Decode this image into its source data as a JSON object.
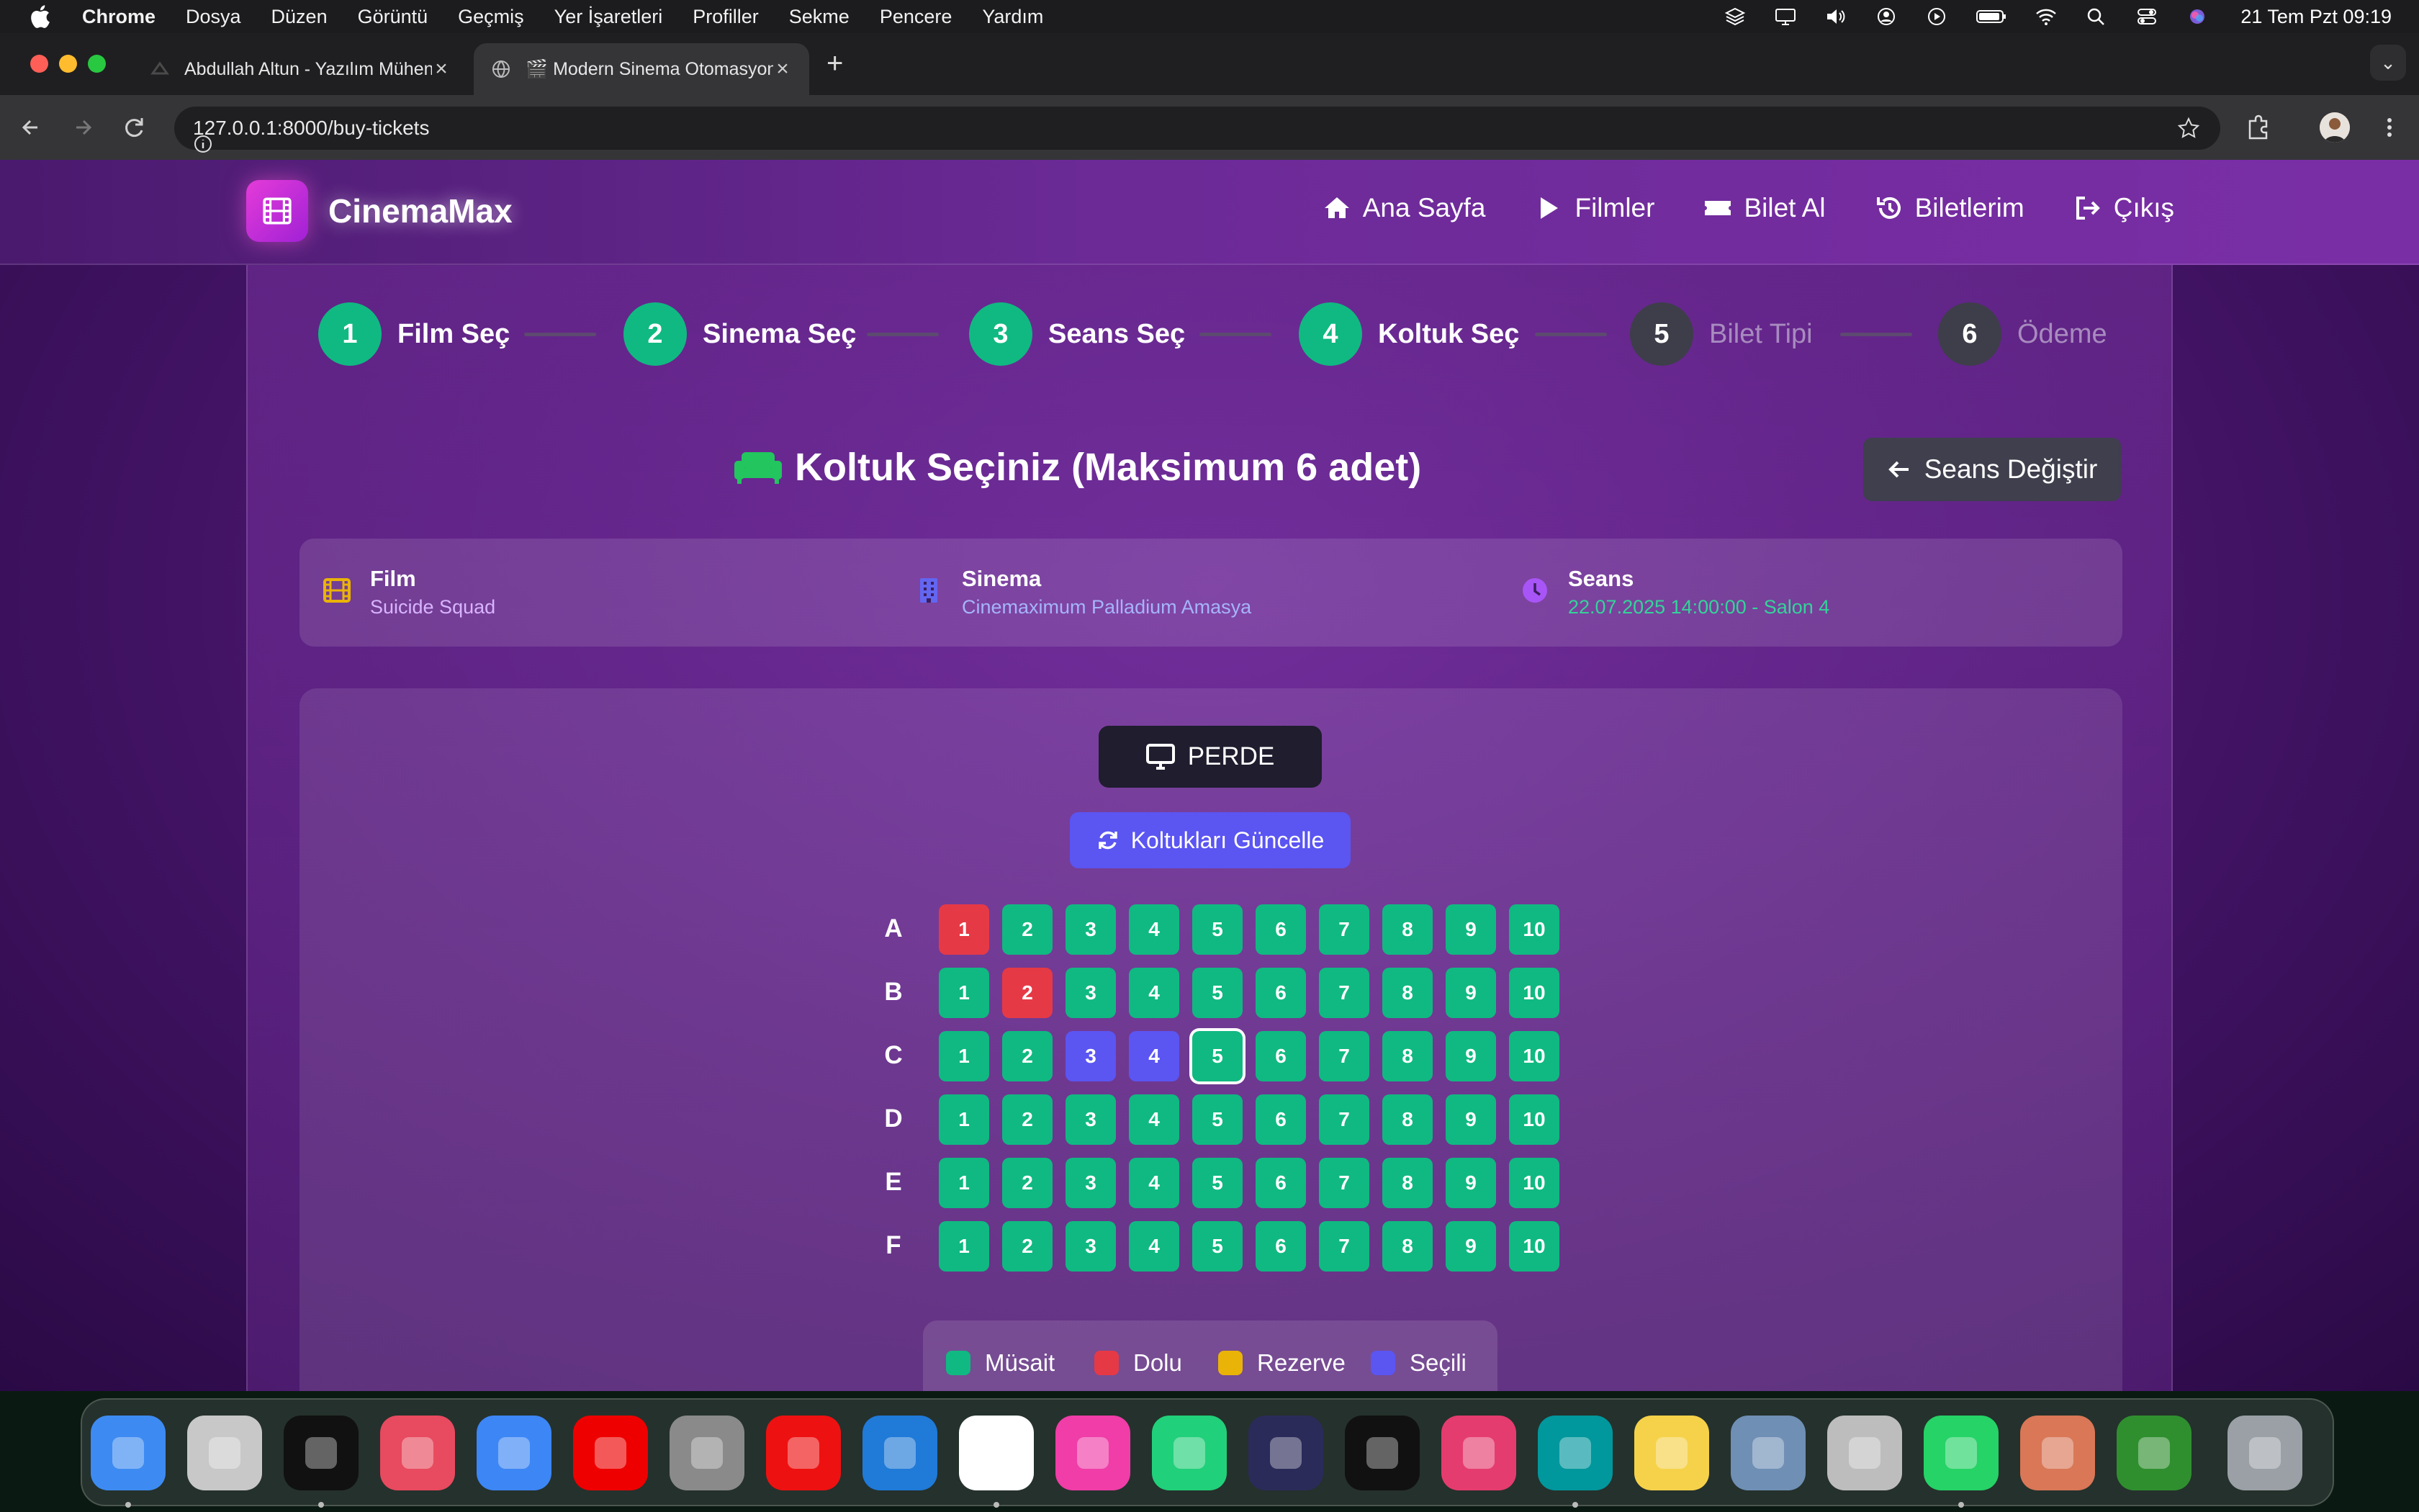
{
  "menubar": {
    "app": "Chrome",
    "items": [
      "Dosya",
      "Düzen",
      "Görüntü",
      "Geçmiş",
      "Yer İşaretleri",
      "Profiller",
      "Sekme",
      "Pencere",
      "Yardım"
    ],
    "clock": "21 Tem Pzt  09:19"
  },
  "browser": {
    "tabs": [
      {
        "title": "Abdullah Altun - Yazılım Mühendisi",
        "active": false
      },
      {
        "title": "🎬 Modern Sinema Otomasyonu",
        "active": true
      }
    ],
    "url": "127.0.0.1:8000/buy-tickets"
  },
  "site": {
    "brand": "CinemaMax",
    "nav": [
      "Ana Sayfa",
      "Filmler",
      "Bilet Al",
      "Biletlerim",
      "Çıkış"
    ]
  },
  "steps": [
    {
      "num": "1",
      "label": "Film Seç",
      "done": true
    },
    {
      "num": "2",
      "label": "Sinema Seç",
      "done": true
    },
    {
      "num": "3",
      "label": "Seans Seç",
      "done": true
    },
    {
      "num": "4",
      "label": "Koltuk Seç",
      "done": true
    },
    {
      "num": "5",
      "label": "Bilet Tipi",
      "done": false
    },
    {
      "num": "6",
      "label": "Ödeme",
      "done": false
    }
  ],
  "page": {
    "heading": "Koltuk Seçiniz (Maksimum 6 adet)",
    "change_session": "Seans Değiştir"
  },
  "info": {
    "film_label": "Film",
    "film_value": "Suicide Squad",
    "cinema_label": "Sinema",
    "cinema_value": "Cinemaximum Palladium Amasya",
    "session_label": "Seans",
    "session_value": "22.07.2025 14:00:00 - Salon 4",
    "colors": {
      "film": "#eab308",
      "cinema": "#6366f1",
      "session": "#a855f7",
      "film_value": "#d8b4fe",
      "cinema_value": "#a5b4fc",
      "session_value": "#34d399"
    }
  },
  "screen": {
    "label": "PERDE",
    "refresh": "Koltukları Güncelle"
  },
  "seating": {
    "rows": [
      {
        "label": "A",
        "seats": [
          "occupied",
          "available",
          "available",
          "available",
          "available",
          "available",
          "available",
          "available",
          "available",
          "available"
        ]
      },
      {
        "label": "B",
        "seats": [
          "available",
          "occupied",
          "available",
          "available",
          "available",
          "available",
          "available",
          "available",
          "available",
          "available"
        ]
      },
      {
        "label": "C",
        "seats": [
          "available",
          "available",
          "selected",
          "selected",
          "available",
          "available",
          "available",
          "available",
          "available",
          "available"
        ]
      },
      {
        "label": "D",
        "seats": [
          "available",
          "available",
          "available",
          "available",
          "available",
          "available",
          "available",
          "available",
          "available",
          "available"
        ]
      },
      {
        "label": "E",
        "seats": [
          "available",
          "available",
          "available",
          "available",
          "available",
          "available",
          "available",
          "available",
          "available",
          "available"
        ]
      },
      {
        "label": "F",
        "seats": [
          "available",
          "available",
          "available",
          "available",
          "available",
          "available",
          "available",
          "available",
          "available",
          "available"
        ]
      }
    ],
    "seat_numbers": [
      "1",
      "2",
      "3",
      "4",
      "5",
      "6",
      "7",
      "8",
      "9",
      "10"
    ],
    "focused": {
      "row": "C",
      "seat": "5"
    }
  },
  "legend": [
    {
      "label": "Müsait",
      "color": "#10b981"
    },
    {
      "label": "Dolu",
      "color": "#e63946"
    },
    {
      "label": "Rezerve",
      "color": "#eab308"
    },
    {
      "label": "Seçili",
      "color": "#5b55f2"
    }
  ],
  "dock": [
    "finder-icon",
    "launchpad-icon",
    "terminal-icon",
    "shortcuts-icon",
    "mail-icon",
    "youtube-icon",
    "system-settings-icon",
    "youtube-music-icon",
    "vscode-icon",
    "chrome-icon",
    "phpstorm-icon",
    "pycharm-icon",
    "eclipse-icon",
    "activity-monitor-icon",
    "intellij-icon",
    "arduino-icon",
    "notes-icon",
    "directory-utility-icon",
    "calculator-icon",
    "whatsapp-icon",
    "claude-icon",
    "chess-icon",
    "trash-icon"
  ]
}
